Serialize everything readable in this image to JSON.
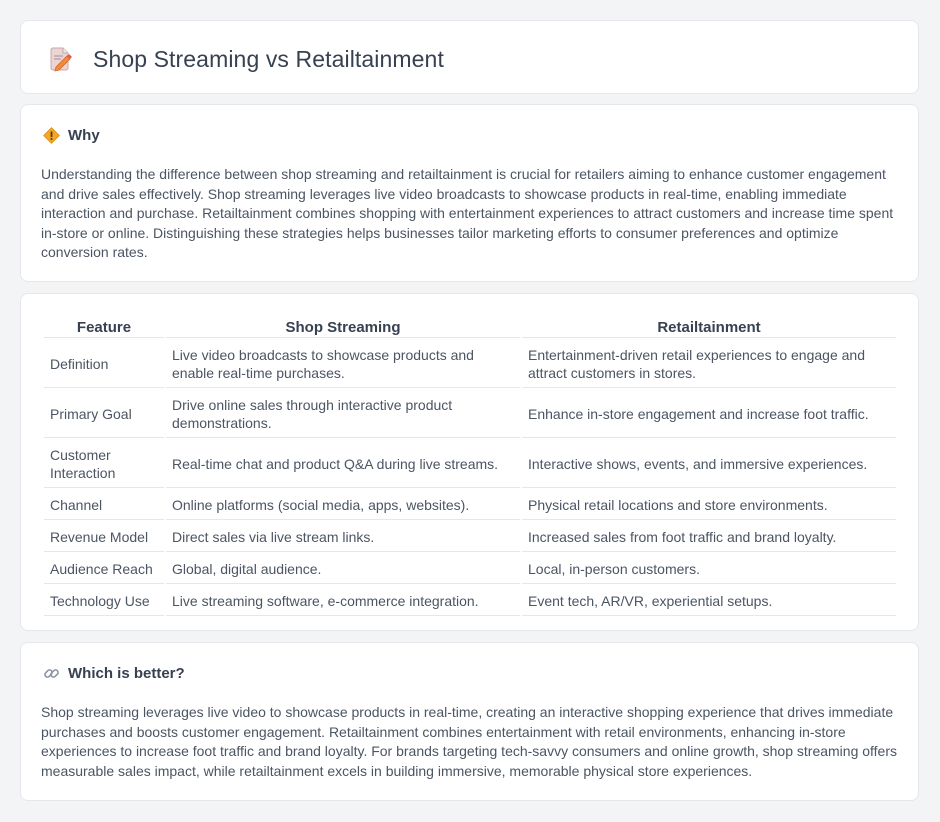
{
  "header": {
    "title": "Shop Streaming vs Retailtainment",
    "icon": "pencil-document-icon"
  },
  "why": {
    "title": "Why",
    "icon": "diamond-sign-icon",
    "text": "Understanding the difference between shop streaming and retailtainment is crucial for retailers aiming to enhance customer engagement and drive sales effectively. Shop streaming leverages live video broadcasts to showcase products in real-time, enabling immediate interaction and purchase. Retailtainment combines shopping with entertainment experiences to attract customers and increase time spent in-store or online. Distinguishing these strategies helps businesses tailor marketing efforts to consumer preferences and optimize conversion rates."
  },
  "comparison": {
    "headers": [
      "Feature",
      "Shop Streaming",
      "Retailtainment"
    ],
    "rows": [
      [
        "Definition",
        "Live video broadcasts to showcase products and enable real-time purchases.",
        "Entertainment-driven retail experiences to engage and attract customers in stores."
      ],
      [
        "Primary Goal",
        "Drive online sales through interactive product demonstrations.",
        "Enhance in-store engagement and increase foot traffic."
      ],
      [
        "Customer Interaction",
        "Real-time chat and product Q&A during live streams.",
        "Interactive shows, events, and immersive experiences."
      ],
      [
        "Channel",
        "Online platforms (social media, apps, websites).",
        "Physical retail locations and store environments."
      ],
      [
        "Revenue Model",
        "Direct sales via live stream links.",
        "Increased sales from foot traffic and brand loyalty."
      ],
      [
        "Audience Reach",
        "Global, digital audience.",
        "Local, in-person customers."
      ],
      [
        "Technology Use",
        "Live streaming software, e-commerce integration.",
        "Event tech, AR/VR, experiential setups."
      ]
    ]
  },
  "better": {
    "title": "Which is better?",
    "icon": "link-icon",
    "text": "Shop streaming leverages live video to showcase products in real-time, creating an interactive shopping experience that drives immediate purchases and boosts customer engagement. Retailtainment combines entertainment with retail environments, enhancing in-store experiences to increase foot traffic and brand loyalty. For brands targeting tech-savvy consumers and online growth, shop streaming offers measurable sales impact, while retailtainment excels in building immersive, memorable physical store experiences."
  }
}
